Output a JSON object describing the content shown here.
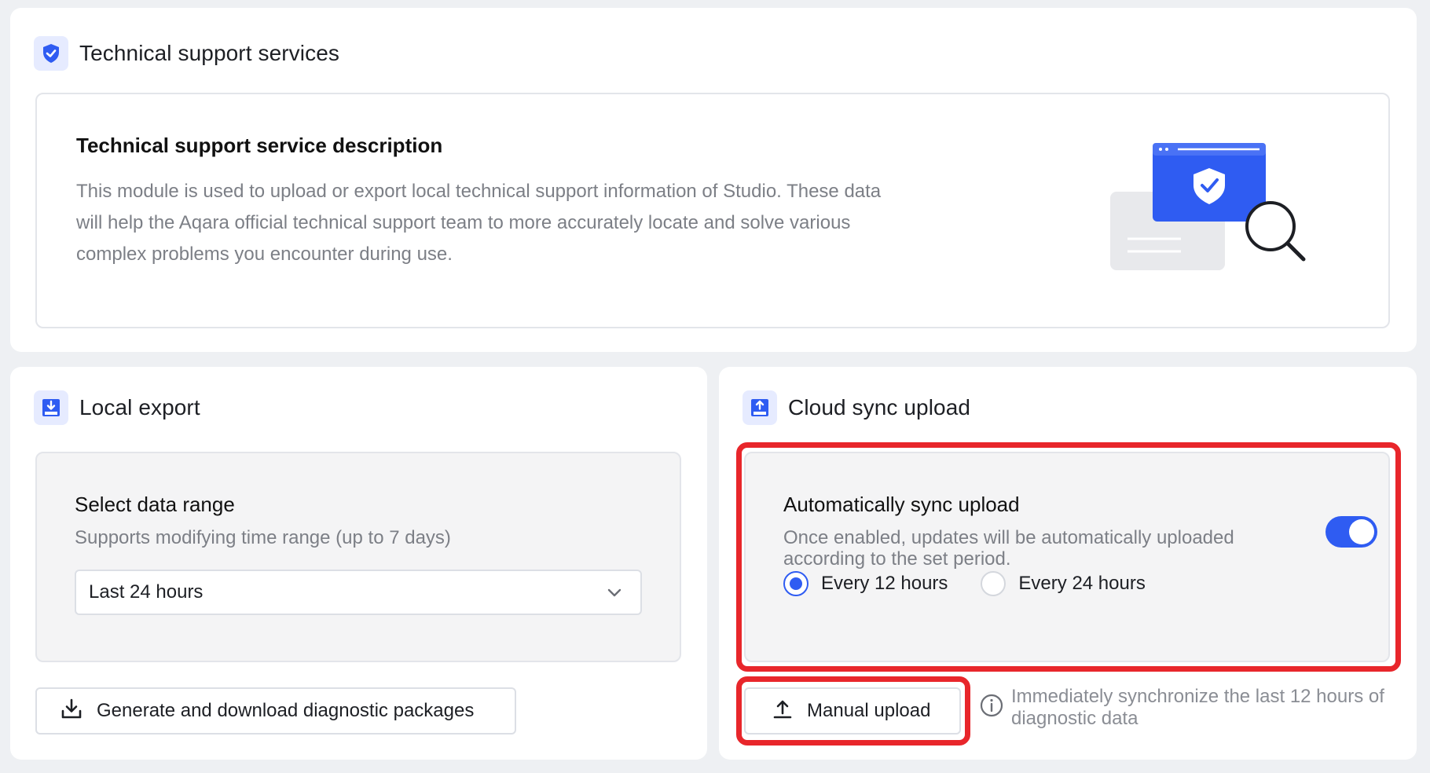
{
  "support": {
    "title": "Technical support services",
    "icon": "shield-check-icon",
    "description_title": "Technical support service description",
    "description_text": "This module is used to upload or export local technical support information of Studio. These data will help the Aqara official technical support team to more accurately locate and solve various complex problems you encounter during use."
  },
  "local_export": {
    "title": "Local export",
    "icon": "download-box-icon",
    "range_title": "Select data range",
    "range_subtitle": "Supports modifying time range (up to 7 days)",
    "range_value": "Last 24 hours",
    "generate_button": "Generate and download diagnostic packages"
  },
  "cloud_sync": {
    "title": "Cloud sync upload",
    "icon": "upload-box-icon",
    "auto_title": "Automatically sync upload",
    "auto_description": "Once enabled, updates will be automatically uploaded according to the set period.",
    "auto_enabled": true,
    "options": [
      {
        "label": "Every 12 hours",
        "selected": true
      },
      {
        "label": "Every 24 hours",
        "selected": false
      }
    ],
    "manual_button": "Manual upload",
    "manual_hint": "Immediately synchronize the last 12 hours of diagnostic data"
  },
  "colors": {
    "accent": "#2f5cf2",
    "highlight": "#e8262b"
  }
}
